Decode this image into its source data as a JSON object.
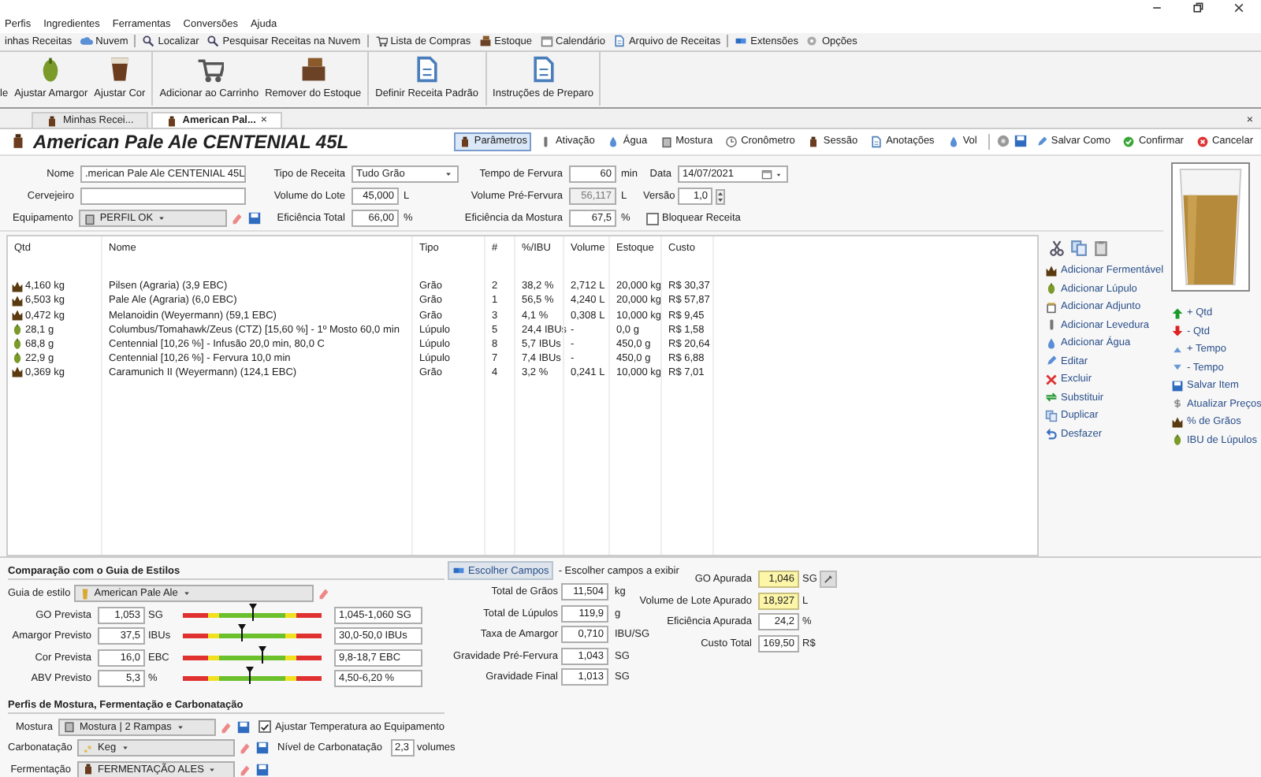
{
  "menu": [
    "Perfis",
    "Ingredientes",
    "Ferramentas",
    "Conversões",
    "Ajuda"
  ],
  "toolbar": [
    [
      "inhas Receitas",
      "Nuvem"
    ],
    [
      "Localizar",
      "Pesquisar Receitas na Nuvem"
    ],
    [
      "Lista de Compras",
      "Estoque",
      "Calendário",
      "Arquivo de Receitas"
    ],
    [
      "Extensões",
      "Opções"
    ]
  ],
  "ribbon": [
    [
      "le",
      "Ajustar Amargor",
      "Ajustar Cor"
    ],
    [
      "Adicionar ao Carrinho",
      "Remover do Estoque"
    ],
    [
      "Definir Receita Padrão"
    ],
    [
      "Instruções de Preparo"
    ]
  ],
  "tabs": [
    {
      "label": "Minhas Recei...",
      "selected": false
    },
    {
      "label": "American Pal...",
      "selected": true
    }
  ],
  "tab_close": "×",
  "panel_close": "×",
  "recipe_title": "American Pale Ale CENTENIAL 45L",
  "views": [
    {
      "label": "Parâmetros",
      "selected": true
    },
    {
      "label": "Ativação",
      "selected": false
    },
    {
      "label": "Água",
      "selected": false
    },
    {
      "label": "Mostura",
      "selected": false
    },
    {
      "label": "Cronômetro",
      "selected": false
    },
    {
      "label": "Sessão",
      "selected": false
    },
    {
      "label": "Anotações",
      "selected": false
    },
    {
      "label": "Vol",
      "selected": false
    }
  ],
  "actions": [
    "Salvar Como",
    "Confirmar",
    "Cancelar"
  ],
  "form": [
    [
      {
        "label": "Nome",
        "kind": "text",
        "value": ".merican Pale Ale CENTENIAL 45L",
        "disabled": false
      },
      {
        "label": "Cervejeiro",
        "kind": "text",
        "disabled": false
      },
      {
        "label": "Equipamento",
        "kind": "picker",
        "value": "PERFIL OK",
        "disabled": false
      }
    ],
    [
      {
        "label": "Tipo de Receita",
        "kind": "select",
        "value": "Tudo Grão",
        "disabled": false
      },
      {
        "label": "Volume do Lote",
        "kind": "number",
        "value": "45,000",
        "unit": "L",
        "disabled": false
      },
      {
        "label": "Eficiência Total",
        "kind": "number",
        "value": "66,00",
        "unit": "%",
        "disabled": false
      }
    ],
    [
      {
        "label": "Tempo de Fervura",
        "kind": "number",
        "value": "60",
        "unit": "min",
        "disabled": false
      },
      {
        "label": "Volume Pré-Fervura",
        "kind": "number",
        "value": "56,117",
        "unit": "L",
        "disabled": true
      },
      {
        "label": "Eficiência da Mostura",
        "kind": "number",
        "value": "67,5",
        "unit": "%",
        "disabled": false
      }
    ],
    [
      {
        "label": "Data",
        "kind": "date",
        "value": "14/07/2021",
        "disabled": false
      },
      {
        "label": "Versão",
        "kind": "spinner",
        "value": "1,0",
        "disabled": false
      },
      {
        "label": "Bloquear Receita",
        "kind": "checkbox",
        "checked": false,
        "disabled": false
      }
    ]
  ],
  "table": {
    "columns": [
      "Qtd",
      "Nome",
      "Tipo",
      "#",
      "%/IBU",
      "Volume",
      "Estoque",
      "Custo"
    ],
    "rows": [
      {
        "kind": "grain",
        "cells": [
          "4,160 kg",
          "Pilsen (Agraria) (3,9 EBC)",
          "Grão",
          "2",
          "38,2 %",
          "2,712 L",
          "20,000 kg",
          "R$ 30,37"
        ]
      },
      {
        "kind": "grain",
        "cells": [
          "6,503 kg",
          "Pale Ale (Agraria) (6,0 EBC)",
          "Grão",
          "1",
          "56,5 %",
          "4,240 L",
          "20,000 kg",
          "R$ 57,87"
        ]
      },
      {
        "kind": "grain",
        "cells": [
          "0,472 kg",
          "Melanoidin (Weyermann) (59,1 EBC)",
          "Grão",
          "3",
          "4,1 %",
          "0,308 L",
          "10,000 kg",
          "R$ 9,45"
        ]
      },
      {
        "kind": "hop",
        "cells": [
          "28,1 g",
          "Columbus/Tomahawk/Zeus (CTZ) [15,60 %] - 1º Mosto 60,0 min",
          "Lúpulo",
          "5",
          "24,4 IBUs",
          "-",
          "0,0 g",
          "R$ 1,58"
        ]
      },
      {
        "kind": "hop",
        "cells": [
          "68,8 g",
          "Centennial [10,26 %] - Infusão  20,0 min, 80,0 C",
          "Lúpulo",
          "8",
          "5,7 IBUs",
          "-",
          "450,0 g",
          "R$ 20,64"
        ]
      },
      {
        "kind": "hop",
        "cells": [
          "22,9 g",
          "Centennial [10,26 %] - Fervura 10,0 min",
          "Lúpulo",
          "7",
          "7,4 IBUs",
          "-",
          "450,0 g",
          "R$ 6,88"
        ]
      },
      {
        "kind": "grain",
        "cells": [
          "0,369 kg",
          "Caramunich II (Weyermann) (124,1 EBC)",
          "Grão",
          "4",
          "3,2 %",
          "0,241 L",
          "10,000 kg",
          "R$ 7,01"
        ]
      }
    ]
  },
  "side_actions": [
    "Adicionar Fermentável",
    "Adicionar Lúpulo",
    "Adicionar Adjunto",
    "Adicionar Levedura",
    "Adicionar Água",
    "Editar",
    "Excluir",
    "Substituir",
    "Duplicar",
    "Desfazer"
  ],
  "item_actions": [
    "+ Qtd",
    "- Qtd",
    "+ Tempo",
    "- Tempo",
    "Salvar Item",
    "Atualizar Preços",
    "% de Grãos",
    "IBU de Lúpulos"
  ],
  "style_guide": {
    "title": "Comparação com o Guia de Estilos",
    "guide_label": "Guia de estilo",
    "guide_value": "American Pale Ale",
    "rows": [
      {
        "label": "GO Prevista",
        "value": "1,053",
        "unit": "SG",
        "level": 0.51,
        "range": "1,045-1,060 SG"
      },
      {
        "label": "Amargor Previsto",
        "value": "37,5",
        "unit": "IBUs",
        "level": 0.43,
        "range": "30,0-50,0 IBUs"
      },
      {
        "label": "Cor Prevista",
        "value": "16,0",
        "unit": "EBC",
        "level": 0.57,
        "range": "9,8-18,7 EBC"
      },
      {
        "label": "ABV Previsto",
        "value": "5,3",
        "unit": "%",
        "level": 0.48,
        "range": "4,50-6,20 %"
      }
    ]
  },
  "profiles": {
    "title": "Perfis de Mostura, Fermentação e Carbonatação",
    "rows": [
      {
        "label": "Mostura",
        "value": "Mostura | 2 Rampas"
      },
      {
        "label": "Carbonatação",
        "value": "Keg"
      },
      {
        "label": "Fermentação",
        "value": "FERMENTAÇÃO ALES"
      }
    ],
    "adjust_temp": {
      "label": "Ajustar Temperatura ao Equipamento",
      "checked": true
    },
    "carbonation": {
      "label": "Nível de Carbonatação",
      "value": "2,3",
      "unit": "volumes"
    }
  },
  "stats": {
    "button": "Escolher Campos",
    "hint": "- Escolher campos a exibir",
    "rows": [
      {
        "label": "Total de Grãos",
        "value": "11,504",
        "unit": "kg"
      },
      {
        "label": "Total de Lúpulos",
        "value": "119,9",
        "unit": "g"
      },
      {
        "label": "Taxa de Amargor",
        "value": "0,710",
        "unit": "IBU/SG"
      },
      {
        "label": "Gravidade Pré-Fervura",
        "value": "1,043",
        "unit": "SG"
      },
      {
        "label": "Gravidade Final",
        "value": "1,013",
        "unit": "SG"
      }
    ]
  },
  "measured": {
    "rows": [
      {
        "label": "GO Apurada",
        "value": "1,046",
        "unit": "SG",
        "highlighted": true
      },
      {
        "label": "Volume de Lote Apurado",
        "value": "18,927",
        "unit": "L",
        "highlighted": true
      },
      {
        "label": "Eficiência Apurada",
        "value": "24,2",
        "unit": "%",
        "highlighted": false
      },
      {
        "label": "Custo Total",
        "value": "169,50",
        "unit": "R$",
        "highlighted": false
      }
    ]
  }
}
